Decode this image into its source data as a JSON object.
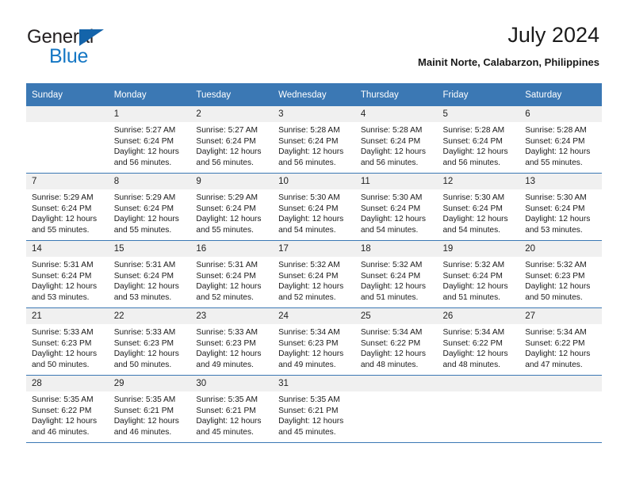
{
  "brand": {
    "name_dark": "General",
    "name_blue": "Blue",
    "accent_color": "#1577c4",
    "triangle_color": "#1464aa"
  },
  "header": {
    "title": "July 2024",
    "subtitle": "Mainit Norte, Calabarzon, Philippines",
    "header_bg": "#3b78b4",
    "daynum_bg": "#f0f0f0"
  },
  "weekdays": [
    "Sunday",
    "Monday",
    "Tuesday",
    "Wednesday",
    "Thursday",
    "Friday",
    "Saturday"
  ],
  "labels": {
    "sunrise_prefix": "Sunrise:",
    "sunset_prefix": "Sunset:",
    "daylight_prefix": "Daylight:"
  },
  "weeks": [
    [
      {
        "day": "",
        "line1": "",
        "line2": "",
        "line3": "",
        "line4": ""
      },
      {
        "day": "1",
        "line1": "Sunrise: 5:27 AM",
        "line2": "Sunset: 6:24 PM",
        "line3": "Daylight: 12 hours",
        "line4": "and 56 minutes."
      },
      {
        "day": "2",
        "line1": "Sunrise: 5:27 AM",
        "line2": "Sunset: 6:24 PM",
        "line3": "Daylight: 12 hours",
        "line4": "and 56 minutes."
      },
      {
        "day": "3",
        "line1": "Sunrise: 5:28 AM",
        "line2": "Sunset: 6:24 PM",
        "line3": "Daylight: 12 hours",
        "line4": "and 56 minutes."
      },
      {
        "day": "4",
        "line1": "Sunrise: 5:28 AM",
        "line2": "Sunset: 6:24 PM",
        "line3": "Daylight: 12 hours",
        "line4": "and 56 minutes."
      },
      {
        "day": "5",
        "line1": "Sunrise: 5:28 AM",
        "line2": "Sunset: 6:24 PM",
        "line3": "Daylight: 12 hours",
        "line4": "and 56 minutes."
      },
      {
        "day": "6",
        "line1": "Sunrise: 5:28 AM",
        "line2": "Sunset: 6:24 PM",
        "line3": "Daylight: 12 hours",
        "line4": "and 55 minutes."
      }
    ],
    [
      {
        "day": "7",
        "line1": "Sunrise: 5:29 AM",
        "line2": "Sunset: 6:24 PM",
        "line3": "Daylight: 12 hours",
        "line4": "and 55 minutes."
      },
      {
        "day": "8",
        "line1": "Sunrise: 5:29 AM",
        "line2": "Sunset: 6:24 PM",
        "line3": "Daylight: 12 hours",
        "line4": "and 55 minutes."
      },
      {
        "day": "9",
        "line1": "Sunrise: 5:29 AM",
        "line2": "Sunset: 6:24 PM",
        "line3": "Daylight: 12 hours",
        "line4": "and 55 minutes."
      },
      {
        "day": "10",
        "line1": "Sunrise: 5:30 AM",
        "line2": "Sunset: 6:24 PM",
        "line3": "Daylight: 12 hours",
        "line4": "and 54 minutes."
      },
      {
        "day": "11",
        "line1": "Sunrise: 5:30 AM",
        "line2": "Sunset: 6:24 PM",
        "line3": "Daylight: 12 hours",
        "line4": "and 54 minutes."
      },
      {
        "day": "12",
        "line1": "Sunrise: 5:30 AM",
        "line2": "Sunset: 6:24 PM",
        "line3": "Daylight: 12 hours",
        "line4": "and 54 minutes."
      },
      {
        "day": "13",
        "line1": "Sunrise: 5:30 AM",
        "line2": "Sunset: 6:24 PM",
        "line3": "Daylight: 12 hours",
        "line4": "and 53 minutes."
      }
    ],
    [
      {
        "day": "14",
        "line1": "Sunrise: 5:31 AM",
        "line2": "Sunset: 6:24 PM",
        "line3": "Daylight: 12 hours",
        "line4": "and 53 minutes."
      },
      {
        "day": "15",
        "line1": "Sunrise: 5:31 AM",
        "line2": "Sunset: 6:24 PM",
        "line3": "Daylight: 12 hours",
        "line4": "and 53 minutes."
      },
      {
        "day": "16",
        "line1": "Sunrise: 5:31 AM",
        "line2": "Sunset: 6:24 PM",
        "line3": "Daylight: 12 hours",
        "line4": "and 52 minutes."
      },
      {
        "day": "17",
        "line1": "Sunrise: 5:32 AM",
        "line2": "Sunset: 6:24 PM",
        "line3": "Daylight: 12 hours",
        "line4": "and 52 minutes."
      },
      {
        "day": "18",
        "line1": "Sunrise: 5:32 AM",
        "line2": "Sunset: 6:24 PM",
        "line3": "Daylight: 12 hours",
        "line4": "and 51 minutes."
      },
      {
        "day": "19",
        "line1": "Sunrise: 5:32 AM",
        "line2": "Sunset: 6:24 PM",
        "line3": "Daylight: 12 hours",
        "line4": "and 51 minutes."
      },
      {
        "day": "20",
        "line1": "Sunrise: 5:32 AM",
        "line2": "Sunset: 6:23 PM",
        "line3": "Daylight: 12 hours",
        "line4": "and 50 minutes."
      }
    ],
    [
      {
        "day": "21",
        "line1": "Sunrise: 5:33 AM",
        "line2": "Sunset: 6:23 PM",
        "line3": "Daylight: 12 hours",
        "line4": "and 50 minutes."
      },
      {
        "day": "22",
        "line1": "Sunrise: 5:33 AM",
        "line2": "Sunset: 6:23 PM",
        "line3": "Daylight: 12 hours",
        "line4": "and 50 minutes."
      },
      {
        "day": "23",
        "line1": "Sunrise: 5:33 AM",
        "line2": "Sunset: 6:23 PM",
        "line3": "Daylight: 12 hours",
        "line4": "and 49 minutes."
      },
      {
        "day": "24",
        "line1": "Sunrise: 5:34 AM",
        "line2": "Sunset: 6:23 PM",
        "line3": "Daylight: 12 hours",
        "line4": "and 49 minutes."
      },
      {
        "day": "25",
        "line1": "Sunrise: 5:34 AM",
        "line2": "Sunset: 6:22 PM",
        "line3": "Daylight: 12 hours",
        "line4": "and 48 minutes."
      },
      {
        "day": "26",
        "line1": "Sunrise: 5:34 AM",
        "line2": "Sunset: 6:22 PM",
        "line3": "Daylight: 12 hours",
        "line4": "and 48 minutes."
      },
      {
        "day": "27",
        "line1": "Sunrise: 5:34 AM",
        "line2": "Sunset: 6:22 PM",
        "line3": "Daylight: 12 hours",
        "line4": "and 47 minutes."
      }
    ],
    [
      {
        "day": "28",
        "line1": "Sunrise: 5:35 AM",
        "line2": "Sunset: 6:22 PM",
        "line3": "Daylight: 12 hours",
        "line4": "and 46 minutes."
      },
      {
        "day": "29",
        "line1": "Sunrise: 5:35 AM",
        "line2": "Sunset: 6:21 PM",
        "line3": "Daylight: 12 hours",
        "line4": "and 46 minutes."
      },
      {
        "day": "30",
        "line1": "Sunrise: 5:35 AM",
        "line2": "Sunset: 6:21 PM",
        "line3": "Daylight: 12 hours",
        "line4": "and 45 minutes."
      },
      {
        "day": "31",
        "line1": "Sunrise: 5:35 AM",
        "line2": "Sunset: 6:21 PM",
        "line3": "Daylight: 12 hours",
        "line4": "and 45 minutes."
      },
      {
        "day": "",
        "line1": "",
        "line2": "",
        "line3": "",
        "line4": ""
      },
      {
        "day": "",
        "line1": "",
        "line2": "",
        "line3": "",
        "line4": ""
      },
      {
        "day": "",
        "line1": "",
        "line2": "",
        "line3": "",
        "line4": ""
      }
    ]
  ]
}
